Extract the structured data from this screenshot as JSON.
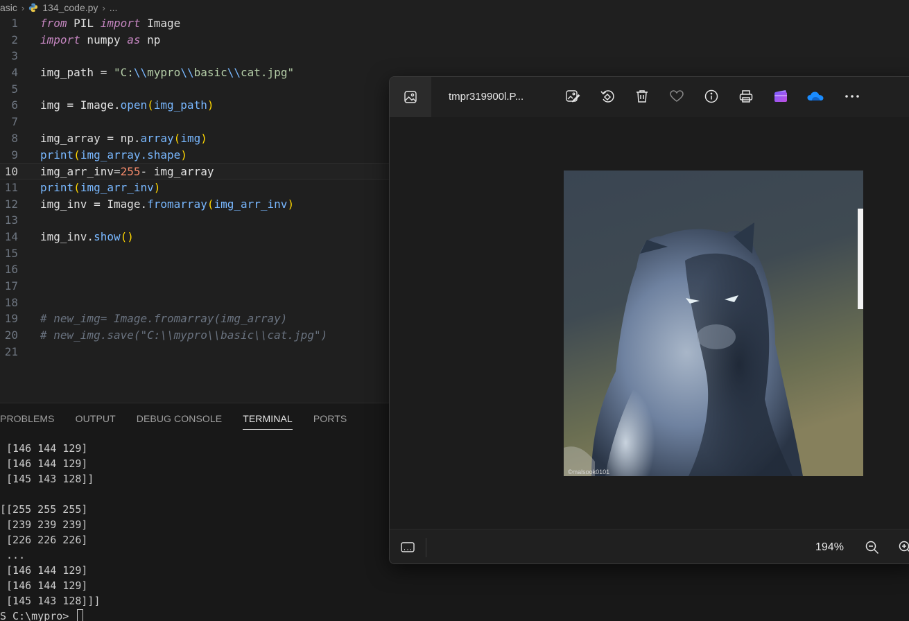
{
  "breadcrumb": {
    "folder": "asic",
    "file": "134_code.py",
    "more": "..."
  },
  "editor": {
    "current_line": 10,
    "lines": [
      {
        "n": "1"
      },
      {
        "n": "2"
      },
      {
        "n": "3"
      },
      {
        "n": "4"
      },
      {
        "n": "5"
      },
      {
        "n": "6"
      },
      {
        "n": "7"
      },
      {
        "n": "8"
      },
      {
        "n": "9"
      },
      {
        "n": "10"
      },
      {
        "n": "11"
      },
      {
        "n": "12"
      },
      {
        "n": "13"
      },
      {
        "n": "14"
      },
      {
        "n": "15"
      },
      {
        "n": "16"
      },
      {
        "n": "17"
      },
      {
        "n": "18"
      },
      {
        "n": "19"
      },
      {
        "n": "20"
      },
      {
        "n": "21"
      }
    ],
    "code": {
      "l1_from": "from",
      "l1_mod": " PIL ",
      "l1_import": "import",
      "l1_name": " Image",
      "l2_import": "import",
      "l2_mod": " numpy ",
      "l2_as": "as",
      "l2_alias": " np",
      "l4_var": "img_path = ",
      "l4_q1": "\"C:",
      "l4_e1": "\\\\",
      "l4_s1": "mypro",
      "l4_e2": "\\\\",
      "l4_s2": "basic",
      "l4_e3": "\\\\",
      "l4_s3": "cat.jpg",
      "l4_q2": "\"",
      "l6_var": "img = Image.",
      "l6_fn": "open",
      "l6_p1": "(",
      "l6_arg": "img_path",
      "l6_p2": ")",
      "l8_var": "img_array = np.",
      "l8_fn": "array",
      "l8_p1": "(",
      "l8_arg": "img",
      "l8_p2": ")",
      "l9_fn": "print",
      "l9_p1": "(",
      "l9_arg": "img_array.shape",
      "l9_p2": ")",
      "l10_var": "img_arr_inv=",
      "l10_num": "255",
      "l10_rest": "- img_array",
      "l11_fn": "print",
      "l11_p1": "(",
      "l11_arg": "img_arr_inv",
      "l11_p2": ")",
      "l12_var": "img_inv = Image.",
      "l12_fn": "fromarray",
      "l12_p1": "(",
      "l12_arg": "img_arr_inv",
      "l12_p2": ")",
      "l14_var": "img_inv.",
      "l14_fn": "show",
      "l14_p": "()",
      "l19": "# new_img= Image.fromarray(img_array)",
      "l20": "# new_img.save(\"C:\\\\mypro\\\\basic\\\\cat.jpg\")"
    }
  },
  "panel": {
    "tabs": [
      "PROBLEMS",
      "OUTPUT",
      "DEBUG CONSOLE",
      "TERMINAL",
      "PORTS"
    ],
    "active_tab": "TERMINAL",
    "terminal_lines": [
      " [146 144 129]",
      " [146 144 129]",
      " [145 143 128]]",
      "",
      "[[255 255 255]",
      " [239 239 239]",
      " [226 226 226]",
      " ...",
      " [146 144 129]",
      " [146 144 129]",
      " [145 143 128]]]"
    ],
    "prompt": "S C:\\mypro> "
  },
  "viewer": {
    "title": "tmpr319900l.P...",
    "zoom": "194%",
    "watermark": "©malsook0101"
  },
  "colors": {
    "accent": "#0078d4",
    "editor_bg": "#1f1f1f",
    "panel_bg": "#181818"
  }
}
